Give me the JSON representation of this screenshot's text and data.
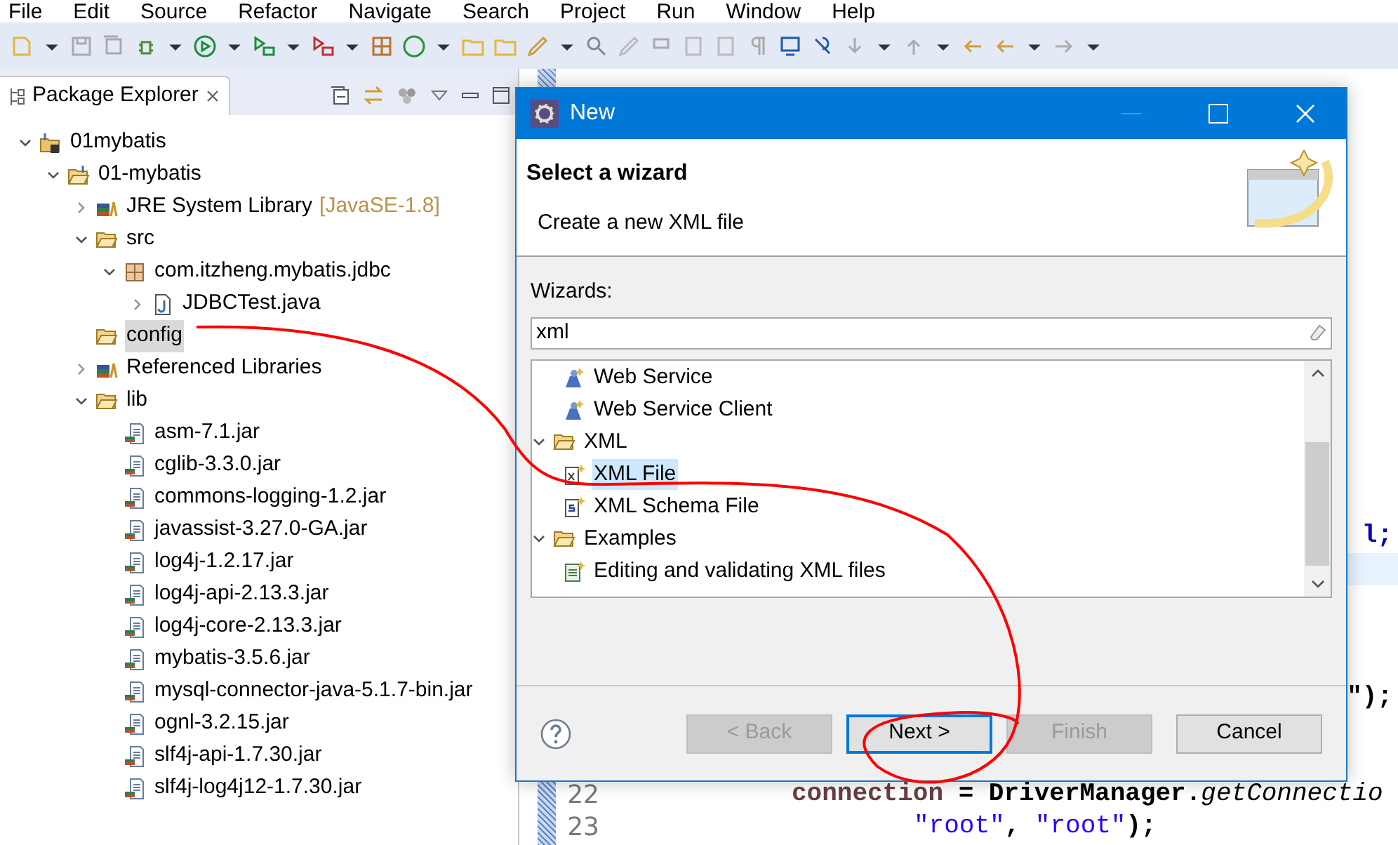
{
  "menu_bar": [
    "File",
    "Edit",
    "Source",
    "Refactor",
    "Navigate",
    "Search",
    "Project",
    "Run",
    "Window",
    "Help"
  ],
  "package_explorer": {
    "title": "Package Explorer",
    "tree": [
      {
        "label": "01mybatis",
        "kind": "project",
        "expanded": true,
        "selected": false,
        "children": [
          {
            "label": "01-mybatis",
            "kind": "source-project",
            "expanded": true,
            "selected": false,
            "children": [
              {
                "label": "JRE System Library",
                "decoration": "[JavaSE-1.8]",
                "kind": "library",
                "expanded": false,
                "selected": false
              },
              {
                "label": "src",
                "kind": "folder",
                "expanded": true,
                "selected": false,
                "children": [
                  {
                    "label": "com.itzheng.mybatis.jdbc",
                    "kind": "package",
                    "expanded": true,
                    "selected": false,
                    "children": [
                      {
                        "label": "JDBCTest.java",
                        "kind": "java",
                        "expanded": false,
                        "selected": false
                      }
                    ]
                  }
                ]
              },
              {
                "label": "config",
                "kind": "folder",
                "selected": true
              },
              {
                "label": "Referenced Libraries",
                "kind": "library",
                "expanded": false,
                "selected": false
              },
              {
                "label": "lib",
                "kind": "plain-folder",
                "expanded": true,
                "selected": false,
                "children": [
                  {
                    "label": "asm-7.1.jar",
                    "kind": "jar",
                    "selected": false
                  },
                  {
                    "label": "cglib-3.3.0.jar",
                    "kind": "jar",
                    "selected": false
                  },
                  {
                    "label": "commons-logging-1.2.jar",
                    "kind": "jar",
                    "selected": false
                  },
                  {
                    "label": "javassist-3.27.0-GA.jar",
                    "kind": "jar",
                    "selected": false
                  },
                  {
                    "label": "log4j-1.2.17.jar",
                    "kind": "jar",
                    "selected": false
                  },
                  {
                    "label": "log4j-api-2.13.3.jar",
                    "kind": "jar",
                    "selected": false
                  },
                  {
                    "label": "log4j-core-2.13.3.jar",
                    "kind": "jar",
                    "selected": false
                  },
                  {
                    "label": "mybatis-3.5.6.jar",
                    "kind": "jar",
                    "selected": false
                  },
                  {
                    "label": "mysql-connector-java-5.1.7-bin.jar",
                    "kind": "jar",
                    "selected": false
                  },
                  {
                    "label": "ognl-3.2.15.jar",
                    "kind": "jar",
                    "selected": false
                  },
                  {
                    "label": "slf4j-api-1.7.30.jar",
                    "kind": "jar",
                    "selected": false
                  },
                  {
                    "label": "slf4j-log4j12-1.7.30.jar",
                    "kind": "jar",
                    "selected": false
                  }
                ]
              }
            ]
          }
        ]
      }
    ]
  },
  "editor": {
    "lines": [
      {
        "current": false,
        "kind": "tail",
        "code": [
          {
            "text": "l;",
            "kind": "field"
          }
        ]
      },
      {
        "current": true
      },
      {
        "current": false
      },
      {
        "current": false
      },
      {
        "current": false
      },
      {
        "current": false,
        "kind": "tail",
        "code": [
          {
            "text": "\");",
            "kind": "plain"
          }
        ]
      },
      {
        "current": false
      },
      {
        "current": false
      },
      {
        "current": false,
        "number": "22",
        "kind": "statement",
        "code": [
          {
            "text": "connection",
            "kind": "variable"
          },
          {
            "text": " = DriverManager.",
            "kind": "plain"
          },
          {
            "text": "getConnectio",
            "kind": "method"
          }
        ]
      },
      {
        "current": false,
        "number": "23",
        "kind": "continuation",
        "code": [
          {
            "text": "\"root\"",
            "kind": "string"
          },
          {
            "text": ", ",
            "kind": "plain"
          },
          {
            "text": "\"root\"",
            "kind": "string"
          },
          {
            "text": ");",
            "kind": "plain"
          }
        ]
      }
    ]
  },
  "dialog": {
    "title": "New",
    "heading": "Select a wizard",
    "description": "Create a new XML file",
    "filter_label": "Wizards:",
    "filter_value": "xml",
    "wizard_tree": [
      {
        "children": [
          {
            "label": "Web Service",
            "kind": "web-service",
            "selected": false
          },
          {
            "label": "Web Service Client",
            "kind": "web-service",
            "selected": false
          }
        ]
      },
      {
        "label": "XML",
        "kind": "folder",
        "expanded": true,
        "selected": false,
        "children": [
          {
            "label": "XML File",
            "kind": "xml-file",
            "selected": true
          },
          {
            "label": "XML Schema File",
            "kind": "schema-file",
            "selected": false
          }
        ]
      },
      {
        "label": "Examples",
        "kind": "folder",
        "expanded": true,
        "selected": false,
        "children": [
          {
            "label": "Editing and validating XML files",
            "kind": "example",
            "selected": false
          }
        ]
      }
    ],
    "buttons": [
      {
        "label": "< Back",
        "disabled": true,
        "default": false
      },
      {
        "label": "Next >",
        "disabled": false,
        "default": true
      },
      {
        "label": "Finish",
        "disabled": true,
        "default": false
      },
      {
        "label": "Cancel",
        "disabled": false,
        "default": false
      }
    ]
  }
}
